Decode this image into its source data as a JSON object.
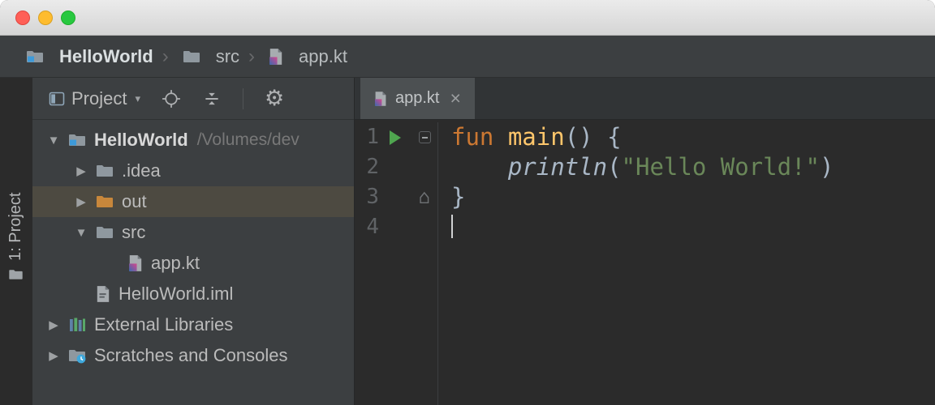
{
  "navbar": {
    "separator": "›",
    "crumbs": [
      {
        "label": "HelloWorld",
        "icon": "project-folder-icon"
      },
      {
        "label": "src",
        "icon": "folder-icon"
      },
      {
        "label": "app.kt",
        "icon": "kotlin-file-icon"
      }
    ]
  },
  "tool_strip": {
    "button": {
      "label": "1: Project",
      "icon": "project-tool-icon"
    }
  },
  "project_panel": {
    "toolbar": {
      "title": "Project",
      "caret": "▾",
      "icons": [
        "view-selector-icon",
        "locate-icon",
        "collapse-all-icon",
        "settings-gear-icon",
        "hide-panel-icon"
      ]
    },
    "arrows": {
      "expanded": "▼",
      "collapsed": "▶"
    },
    "tree": [
      {
        "label": "HelloWorld",
        "detail": "/Volumes/dev",
        "icon": "project-folder-icon",
        "state": "expanded"
      },
      {
        "label": ".idea",
        "icon": "folder-icon",
        "state": "collapsed"
      },
      {
        "label": "out",
        "icon": "excluded-folder-icon",
        "state": "collapsed",
        "selected": true
      },
      {
        "label": "src",
        "icon": "folder-icon",
        "state": "expanded"
      },
      {
        "label": "app.kt",
        "icon": "kotlin-file-icon"
      },
      {
        "label": "HelloWorld.iml",
        "icon": "module-file-icon"
      },
      {
        "label": "External Libraries",
        "icon": "libraries-icon",
        "state": "collapsed"
      },
      {
        "label": "Scratches and Consoles",
        "icon": "scratches-icon",
        "state": "collapsed"
      }
    ]
  },
  "editor": {
    "tab": {
      "label": "app.kt",
      "close": "×",
      "icon": "kotlin-file-icon"
    },
    "gutter": {
      "line_numbers": [
        "1",
        "2",
        "3",
        "4"
      ],
      "run_icon": "run-play-icon"
    },
    "code_lines": [
      {
        "tokens": [
          {
            "t": "fun ",
            "c": "keyword"
          },
          {
            "t": "main",
            "c": "function"
          },
          {
            "t": "() {",
            "c": "plain"
          }
        ]
      },
      {
        "tokens": [
          {
            "t": "    ",
            "c": "plain"
          },
          {
            "t": "println",
            "c": "call"
          },
          {
            "t": "(",
            "c": "plain"
          },
          {
            "t": "\"Hello World!\"",
            "c": "string"
          },
          {
            "t": ")",
            "c": "plain"
          }
        ]
      },
      {
        "tokens": [
          {
            "t": "}",
            "c": "plain"
          }
        ]
      },
      {
        "tokens": []
      }
    ]
  },
  "colors": {
    "panel_bg": "#3c3f41",
    "editor_bg": "#2b2b2b",
    "selected_row_bg": "#4d4a41",
    "keyword": "#cc7832",
    "function_decl": "#ffc66b",
    "string": "#6a8759",
    "plain_code": "#a9b7c6",
    "line_number": "#606366",
    "run_green": "#4fa54f",
    "excluded_folder": "#c8873b"
  }
}
